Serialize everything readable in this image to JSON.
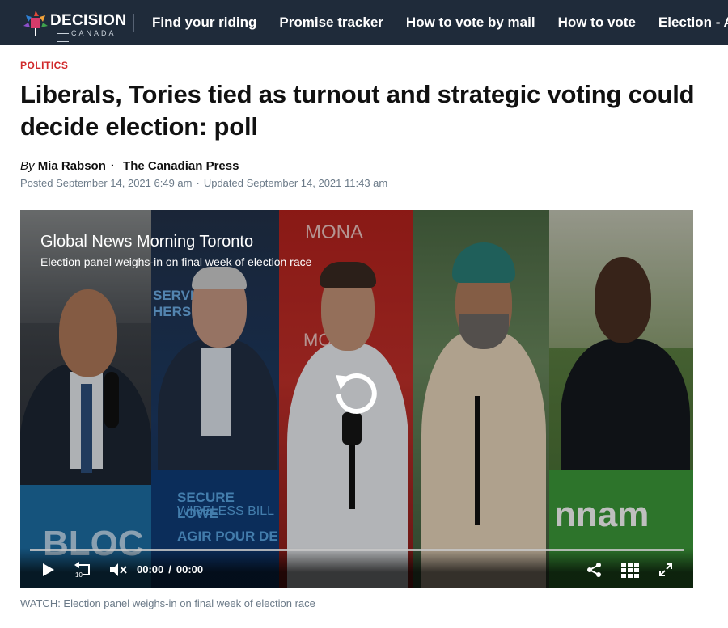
{
  "nav": {
    "logo": {
      "word": "DECISION",
      "sub": "CANADA"
    },
    "links": [
      "Find your riding",
      "Promise tracker",
      "How to vote by mail",
      "How to vote",
      "Election - A"
    ]
  },
  "article": {
    "category": "POLITICS",
    "headline": "Liberals, Tories tied as turnout and strategic voting could decide election: poll",
    "byline": {
      "by": "By",
      "author": "Mia Rabson",
      "source": "The Canadian Press"
    },
    "posted": "Posted September 14, 2021 6:49 am",
    "updated": "Updated September 14, 2021 11:43 am"
  },
  "video": {
    "title": "Global News Morning Toronto",
    "subtitle": "Election panel weighs-in on final week of election race",
    "scene_text": {
      "mona": "MONA",
      "services": "SERVICES",
      "hers": "HERS",
      "secure": "SECURE LOWE",
      "wireless": "WIRELESS BILL",
      "agir": "AGIR POUR DE",
      "bloc": "BLOC",
      "nnam": "nnam",
      "mo": "MO"
    },
    "current_time": "00:00",
    "duration": "00:00",
    "controls": {
      "play": "play-icon",
      "rewind": "rewind-10-icon",
      "mute": "volume-muted-icon",
      "share": "share-icon",
      "grid": "grid-icon",
      "fullscreen": "fullscreen-icon",
      "replay": "replay-icon"
    },
    "caption": "WATCH: Election panel weighs-in on final week of election race"
  },
  "colors": {
    "nav_bg": "#1f2b3a",
    "kicker": "#d0282a",
    "meta_text": "#6b7a88"
  }
}
